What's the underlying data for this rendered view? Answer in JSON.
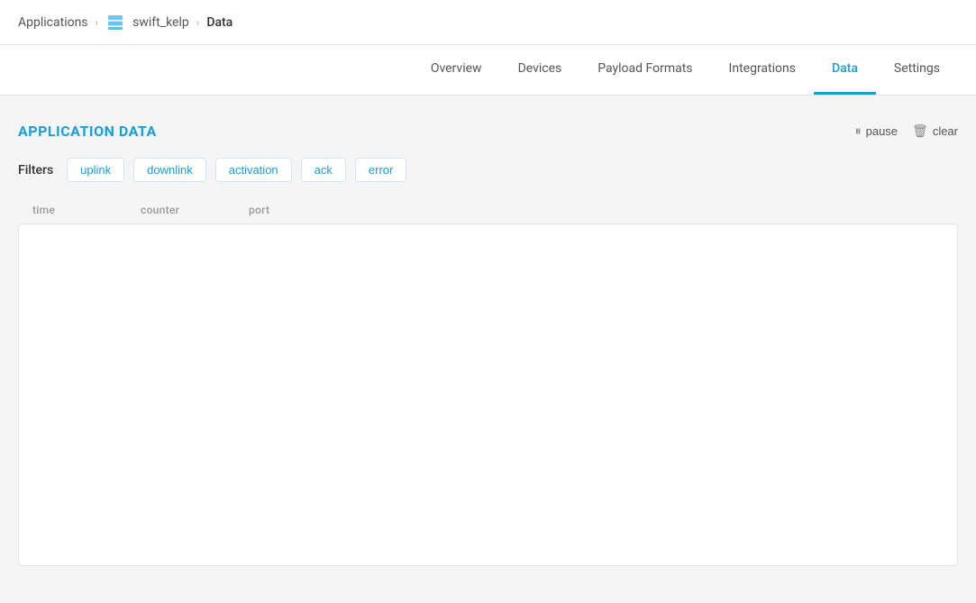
{
  "breadcrumb": {
    "items": [
      {
        "label": "Applications",
        "active": false
      },
      {
        "label": "swift_kelp",
        "active": false,
        "hasLogo": true
      },
      {
        "label": "Data",
        "active": true
      }
    ],
    "separators": [
      "›",
      "›"
    ]
  },
  "tabs": [
    {
      "label": "Overview",
      "active": false,
      "id": "overview"
    },
    {
      "label": "Devices",
      "active": false,
      "id": "devices"
    },
    {
      "label": "Payload Formats",
      "active": false,
      "id": "payload-formats"
    },
    {
      "label": "Integrations",
      "active": false,
      "id": "integrations"
    },
    {
      "label": "Data",
      "active": true,
      "id": "data"
    },
    {
      "label": "Settings",
      "active": false,
      "id": "settings"
    }
  ],
  "main": {
    "section_title": "APPLICATION DATA",
    "actions": {
      "pause_label": "pause",
      "clear_label": "clear"
    },
    "filters": {
      "label": "Filters",
      "items": [
        {
          "label": "uplink",
          "id": "uplink"
        },
        {
          "label": "downlink",
          "id": "downlink"
        },
        {
          "label": "activation",
          "id": "activation"
        },
        {
          "label": "ack",
          "id": "ack"
        },
        {
          "label": "error",
          "id": "error"
        }
      ]
    },
    "table": {
      "columns": [
        {
          "label": "time",
          "id": "time"
        },
        {
          "label": "counter",
          "id": "counter"
        },
        {
          "label": "port",
          "id": "port"
        }
      ]
    }
  }
}
